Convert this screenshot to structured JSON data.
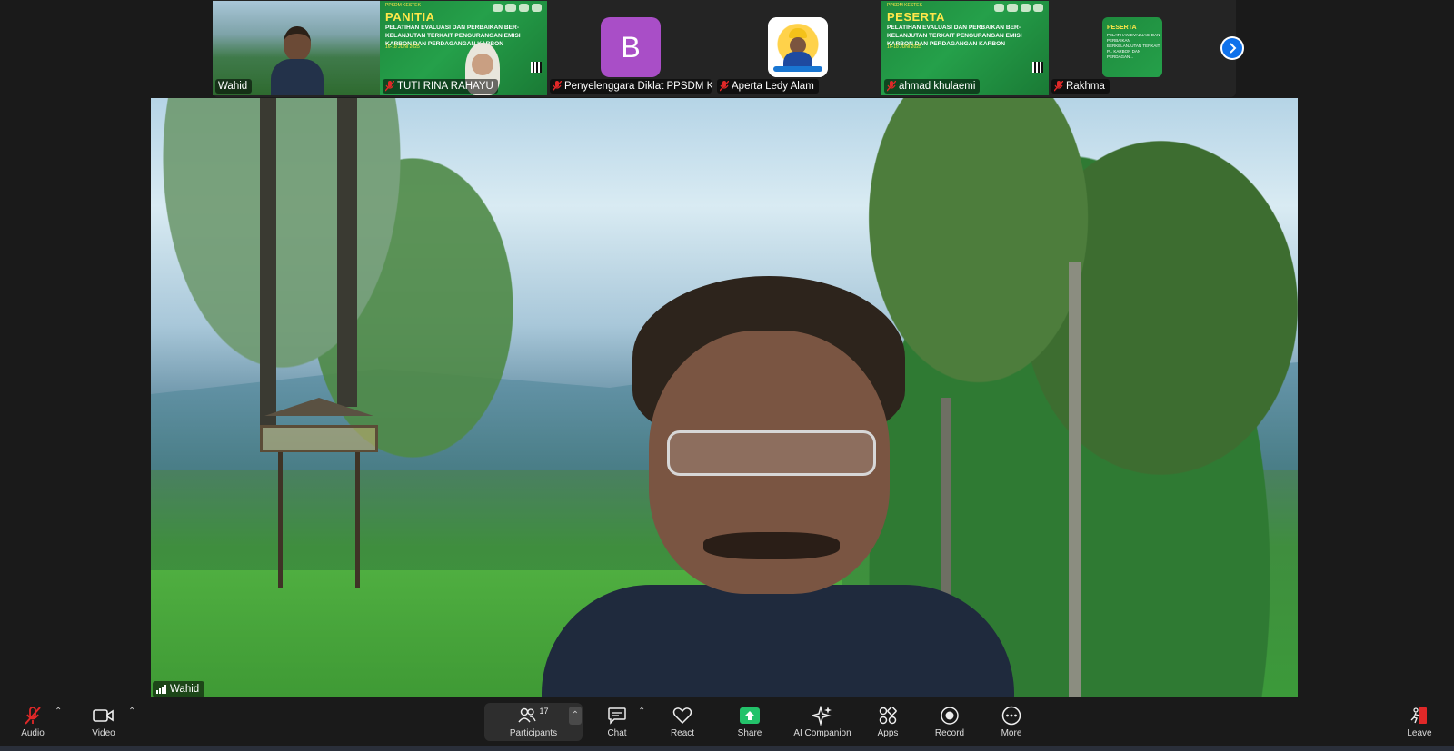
{
  "thumbnails": [
    {
      "name": "Wahid",
      "muted": false,
      "active": true
    },
    {
      "name": "TUTI RINA RAHAYU",
      "muted": true,
      "banner": {
        "title": "PANITIA",
        "subtitle": "PELATIHAN EVALUASI DAN PERBAIKAN BER-KELANJUTAN TERKAIT PENGURANGAN EMISI KARBON DAN PERDAGANGAN KARBON",
        "date": "16-18 JUNI 2025",
        "header": "PPSDM KESTEK"
      }
    },
    {
      "name": "Penyelenggara Diklat PPSDM KE...",
      "muted": true,
      "avatar_letter": "B"
    },
    {
      "name": "Aperta Ledy Alam",
      "muted": true
    },
    {
      "name": "ahmad khulaemi",
      "muted": true,
      "banner": {
        "title": "PESERTA",
        "subtitle": "PELATIHAN EVALUASI DAN PERBAIKAN BER-KELANJUTAN TERKAIT PENGURANGAN EMISI KARBON DAN PERDAGANGAN KARBON",
        "date": "16-18 JUNI 2025",
        "header": "PPSDM KESTEK"
      }
    },
    {
      "name": "Rakhma",
      "muted": true,
      "mini": {
        "title": "PESERTA",
        "subtitle": "PELATIHAN EVALUASI DAN PERBAIKAN BERKELANJUTAN TERKAIT P... KARBON DAN PERDAGAN..."
      }
    }
  ],
  "main": {
    "speaker_name": "Wahid"
  },
  "toolbar": {
    "audio": "Audio",
    "video": "Video",
    "participants": "Participants",
    "participants_count": "17",
    "chat": "Chat",
    "react": "React",
    "share": "Share",
    "ai_companion": "AI Companion",
    "apps": "Apps",
    "record": "Record",
    "more": "More",
    "leave": "Leave"
  },
  "colors": {
    "accent_green": "#1fb86d",
    "share_green": "#23c26a",
    "next_blue": "#0e71eb",
    "mute_red": "#e02828",
    "avatar_purple": "#a94ec7"
  }
}
